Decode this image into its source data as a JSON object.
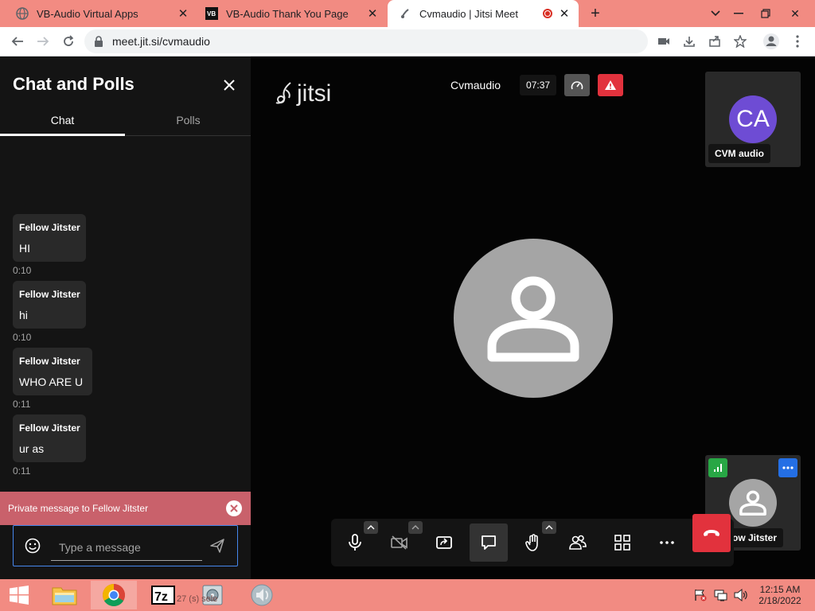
{
  "browser": {
    "tabs": [
      {
        "title": "VB-Audio Virtual Apps",
        "favicon": "globe-icon"
      },
      {
        "title": "VB-Audio Thank You Page",
        "favicon": "vb-logo-icon"
      },
      {
        "title": "Cvmaudio | Jitsi Meet",
        "favicon": "jitsi-icon"
      }
    ],
    "url": "meet.jit.si/cvmaudio"
  },
  "sidebar": {
    "title": "Chat and Polls",
    "tabs": [
      "Chat",
      "Polls"
    ],
    "active_tab": "Chat",
    "messages": [
      {
        "sender": "Fellow Jitster",
        "text": "HI",
        "time": "0:10"
      },
      {
        "sender": "Fellow Jitster",
        "text": "hi",
        "time": "0:10"
      },
      {
        "sender": "Fellow Jitster",
        "text": "WHO ARE U",
        "time": "0:11"
      },
      {
        "sender": "Fellow Jitster",
        "text": "ur as",
        "time": "0:11"
      }
    ],
    "private_banner": "Private message to Fellow Jitster",
    "input_placeholder": "Type a message"
  },
  "stage": {
    "logo": "jitsi",
    "room_name": "Cvmaudio",
    "timer": "07:37",
    "participants": [
      {
        "initials": "CA",
        "name": "CVM audio"
      },
      {
        "name": "Fellow Jitster",
        "name_visible": "ow Jitster"
      }
    ]
  },
  "taskbar": {
    "time": "12:15 AM",
    "date": "2/18/2022",
    "items": [
      "start-icon",
      "file-explorer-icon",
      "chrome-icon",
      "7zip-icon",
      "installer-icon",
      "speaker-app-icon"
    ],
    "peek_text": "27 (s) sele"
  },
  "colors": {
    "tabbar": "#f28b82",
    "sidebar": "#141414",
    "banner": "#c9616b",
    "hangup": "#e2323d",
    "avatar_ca": "#6e4cd4"
  }
}
